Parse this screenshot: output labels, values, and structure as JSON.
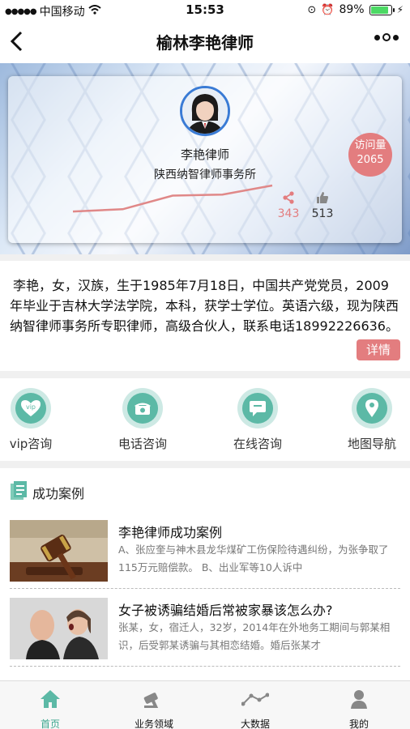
{
  "status": {
    "carrier": "中国移动",
    "time": "15:53",
    "battery": "89%",
    "battery_level": 0.89
  },
  "nav": {
    "title": "榆林李艳律师"
  },
  "profile": {
    "name": "李艳律师",
    "firm": "陕西纳智律师事务所",
    "visits_label": "访问量",
    "visits_count": "2065",
    "shares": "343",
    "likes": "513",
    "trend": [
      10,
      12,
      24,
      25,
      33
    ],
    "colors": {
      "accent": "#e37d7f",
      "avatar_ring": "#3a7bd5"
    }
  },
  "bio": {
    "text": "李艳，女，汉族，生于1985年7月18日，中国共产党党员，2009年毕业于吉林大学法学院，本科，获学士学位。英语六级，现为陕西纳智律师事务所专职律师，高级合伙人，联系电话18992226636。",
    "detail_label": "详情"
  },
  "actions": [
    {
      "label": "vip咨询",
      "icon": "vip-icon"
    },
    {
      "label": "电话咨询",
      "icon": "phone-icon"
    },
    {
      "label": "在线咨询",
      "icon": "chat-icon"
    },
    {
      "label": "地图导航",
      "icon": "map-pin-icon"
    }
  ],
  "cases": {
    "heading": "成功案例",
    "items": [
      {
        "title": "李艳律师成功案例",
        "summary": "A、张应奎与神木县龙华煤矿工伤保险待遇纠纷，为张争取了115万元赔偿款。 B、出业军等10人诉中",
        "thumb": "gavel-image"
      },
      {
        "title": "女子被诱骗结婚后常被家暴该怎么办?",
        "summary": "张某，女，宿迁人，32岁，2014年在外地务工期间与郭某相识，后受郭某诱骗与其相恋结婚。婚后张某才",
        "thumb": "couple-argument-image"
      }
    ]
  },
  "tabbar": [
    {
      "label": "首页",
      "icon": "home-icon",
      "active": true
    },
    {
      "label": "业务领域",
      "icon": "gavel-icon",
      "active": false
    },
    {
      "label": "大数据",
      "icon": "chart-icon",
      "active": false
    },
    {
      "label": "我的",
      "icon": "user-icon",
      "active": false
    }
  ],
  "theme": {
    "teal": "#5cb9a6",
    "tab_active": "#3aa68e"
  }
}
